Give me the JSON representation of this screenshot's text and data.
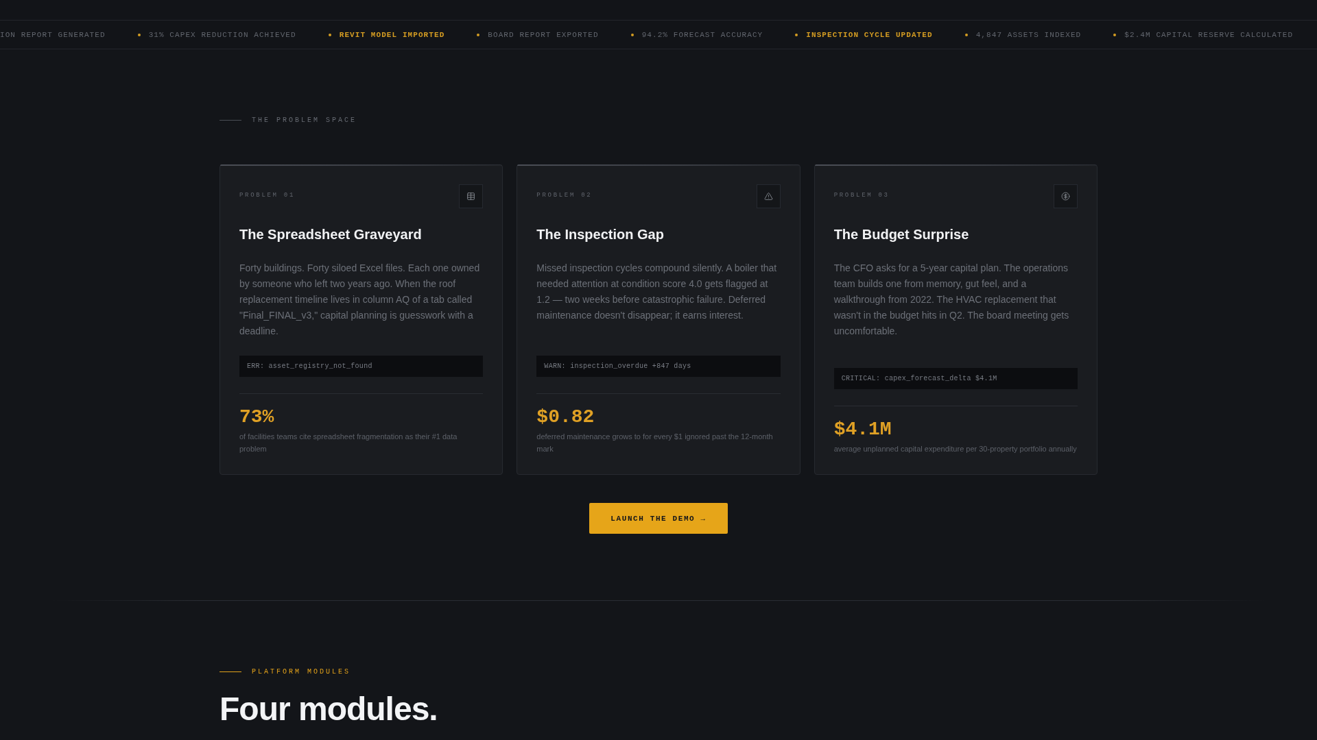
{
  "ticker": {
    "lead": "ION REPORT GENERATED",
    "items": [
      {
        "text": "31% CAPEX REDUCTION ACHIEVED",
        "highlighted": false
      },
      {
        "text": "REVIT MODEL IMPORTED",
        "highlighted": true
      },
      {
        "text": "BOARD REPORT EXPORTED",
        "highlighted": false
      },
      {
        "text": "94.2% FORECAST ACCURACY",
        "highlighted": false
      },
      {
        "text": "INSPECTION CYCLE UPDATED",
        "highlighted": true
      },
      {
        "text": "4,847 ASSETS INDEXED",
        "highlighted": false
      },
      {
        "text": "$2.4M CAPITAL RESERVE CALCULATED",
        "highlighted": false
      }
    ]
  },
  "problem_section": {
    "eyebrow": {
      "text": "THE PROBLEM SPACE",
      "highlighted": false
    },
    "cards": [
      {
        "label": "PROBLEM 01",
        "kind": "table",
        "title": "The Spreadsheet Graveyard",
        "body": "Forty buildings. Forty siloed Excel files. Each one owned by someone who left two years ago. When the roof replacement timeline lives in column AQ of a tab called \"Final_FINAL_v3,\" capital planning is guesswork with a deadline.",
        "code": "ERR: asset_registry_not_found",
        "stat": "73%",
        "stat_caption": "of facilities teams cite spreadsheet fragmentation as their #1 data problem"
      },
      {
        "label": "PROBLEM 02",
        "kind": "alert",
        "title": "The Inspection Gap",
        "body": "Missed inspection cycles compound silently. A boiler that needed attention at condition score 4.0 gets flagged at 1.2 — two weeks before catastrophic failure. Deferred maintenance doesn't disappear; it earns interest.",
        "code": "WARN: inspection_overdue +847 days",
        "stat": "$0.82",
        "stat_caption": "deferred maintenance grows to for every $1 ignored past the 12-month mark"
      },
      {
        "label": "PROBLEM 03",
        "kind": "budget",
        "title": "The Budget Surprise",
        "body": "The CFO asks for a 5-year capital plan. The operations team builds one from memory, gut feel, and a walkthrough from 2022. The HVAC replacement that wasn't in the budget hits in Q2. The board meeting gets uncomfortable.",
        "code": "CRITICAL: capex_forecast_delta $4.1M",
        "stat": "$4.1M",
        "stat_caption": "average unplanned capital expenditure per 30-property portfolio annually"
      }
    ],
    "cta": "LAUNCH THE DEMO →"
  },
  "modules_section": {
    "eyebrow": {
      "text": "PLATFORM MODULES",
      "highlighted": true
    },
    "heading": "Four modules."
  }
}
